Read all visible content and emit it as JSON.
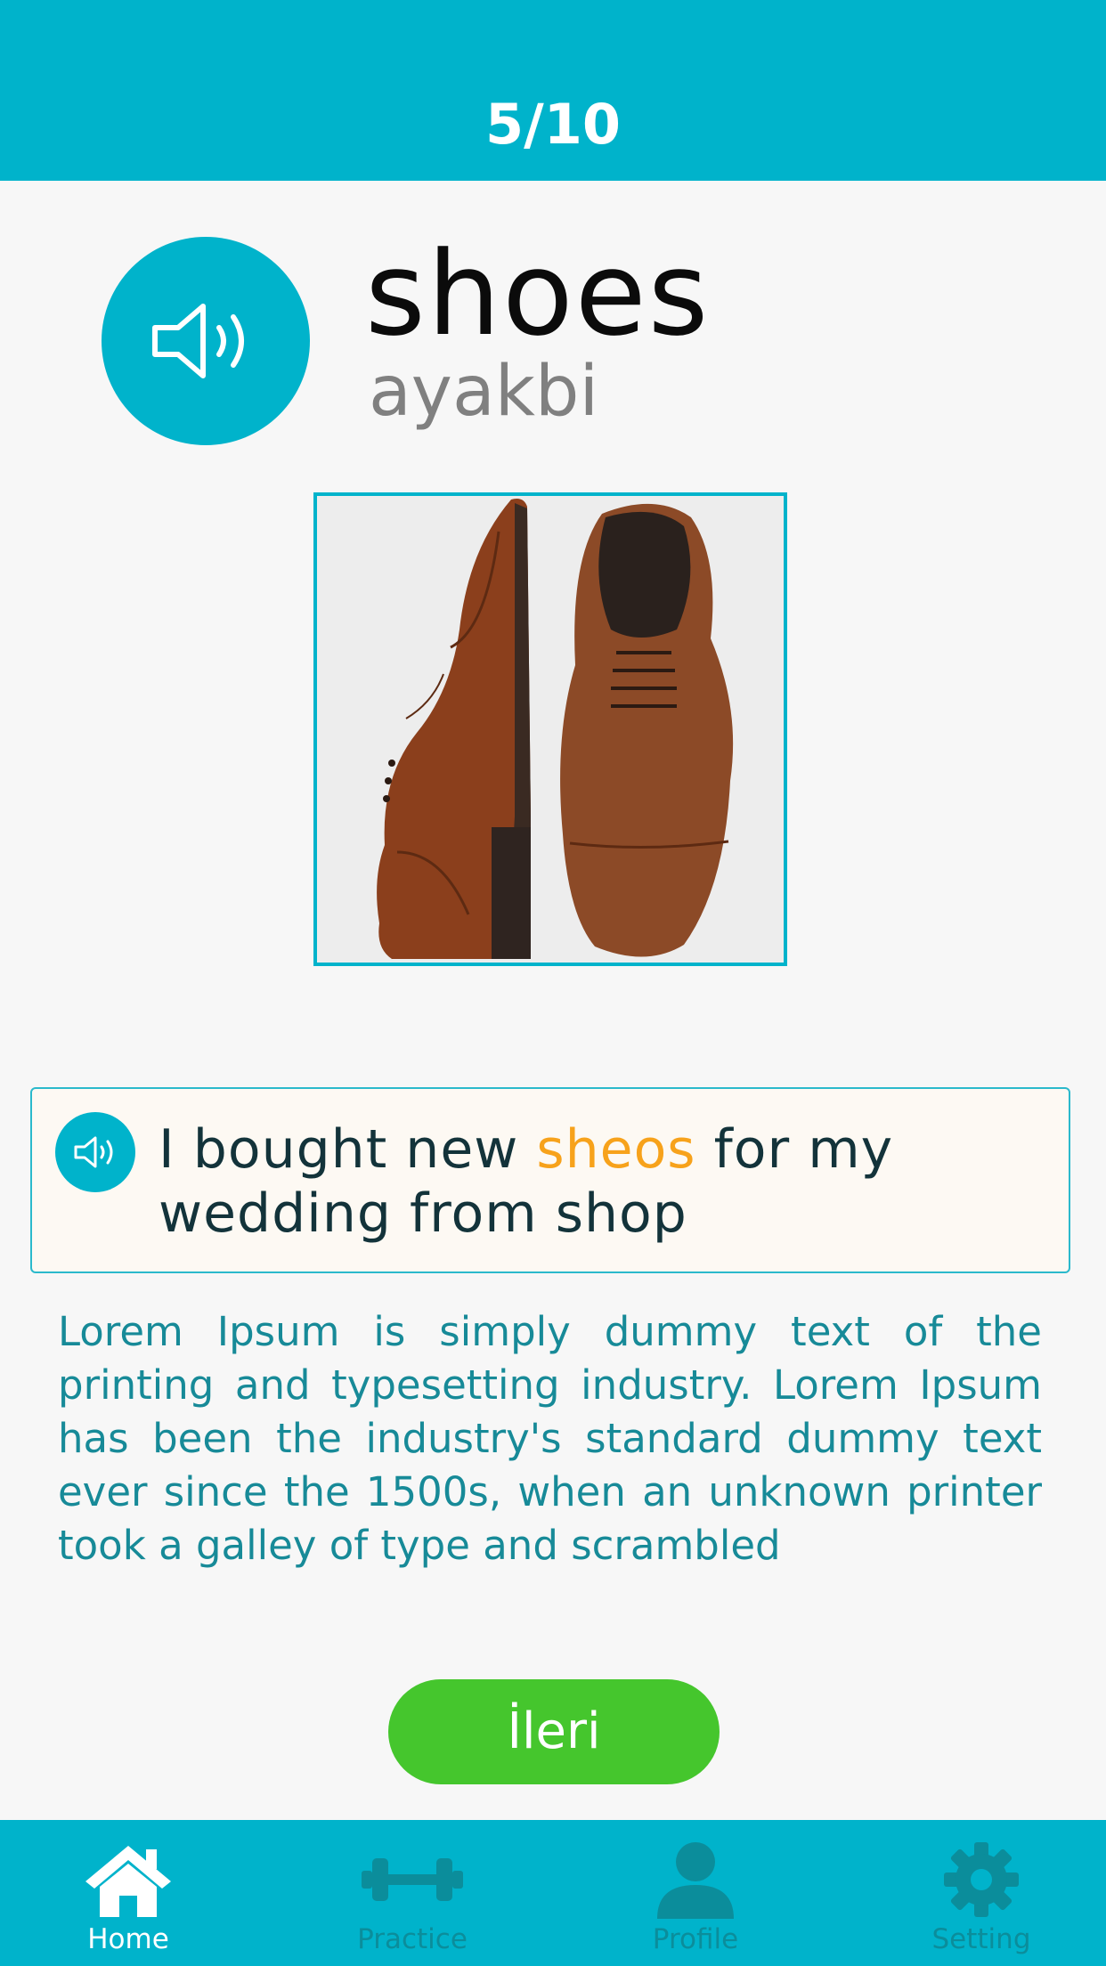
{
  "header": {
    "progress": "5/10"
  },
  "word": {
    "text": "shoes",
    "translation": "ayakbi"
  },
  "image": {
    "icon": "shoe-image"
  },
  "example": {
    "before": "I bought new ",
    "highlight": "sheos",
    "after": " for my wedding from shop"
  },
  "description": "Lorem Ipsum is simply dummy text of the printing and typesetting industry. Lorem Ipsum has been the industry's standard dummy text ever since the 1500s, when an unknown printer took a galley of type and scrambled",
  "next_button": {
    "label": "İleri"
  },
  "tabs": [
    {
      "label": "Home",
      "icon": "home-icon",
      "active": true
    },
    {
      "label": "Practice",
      "icon": "dumbbell-icon",
      "active": false
    },
    {
      "label": "Profile",
      "icon": "user-icon",
      "active": false
    },
    {
      "label": "Setting",
      "icon": "gear-icon",
      "active": false
    }
  ],
  "colors": {
    "accent": "#00b3cb",
    "highlight": "#f7a21b",
    "button": "#45c62d",
    "description_text": "#178a98",
    "inactive_tab": "#0b8d9b"
  }
}
